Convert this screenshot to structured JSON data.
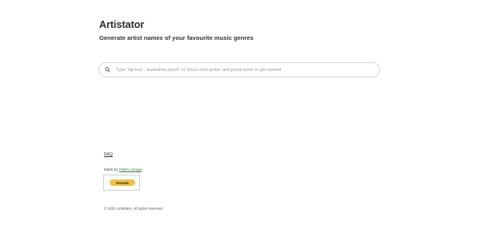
{
  "app": {
    "title": "Artistator",
    "subtitle": "Generate artist names of your favourite music genres"
  },
  "search": {
    "placeholder": "Type 'hip-hop', 'australian psych' or 'blues rock guitar' and press enter to get started",
    "icon": "search-icon"
  },
  "footer": {
    "faq_label": "FAQ",
    "made_by_prefix": "Made by ",
    "author_name": "Pablo Lazaga",
    "donate_label": "Donate",
    "copyright": "© 2021 Artistator. All rights reserved."
  },
  "colors": {
    "donate_button": "#f3c244",
    "author_link": "#3a7a3a"
  }
}
